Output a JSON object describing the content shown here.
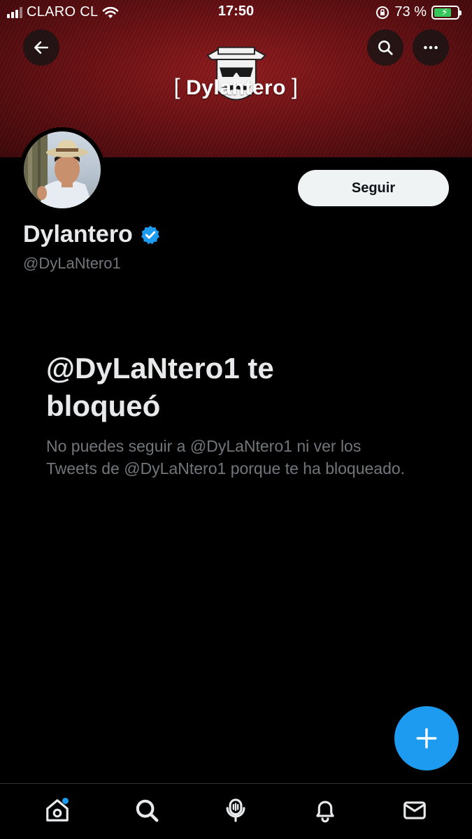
{
  "status_bar": {
    "carrier": "CLARO CL",
    "time": "17:50",
    "battery_percent": "73 %",
    "battery_level": 0.73
  },
  "header": {
    "back_icon": "arrow-left-icon",
    "search_icon": "search-icon",
    "more_icon": "more-horizontal-icon",
    "banner_logo_text": "Dylantero"
  },
  "profile": {
    "display_name": "Dylantero",
    "verified_icon": "verified-badge-icon",
    "handle": "@DyLaNtero1",
    "follow_label": "Seguir"
  },
  "blocked": {
    "title": "@DyLaNtero1 te bloqueó",
    "description": "No puedes seguir a @DyLaNtero1 ni ver los Tweets de @DyLaNtero1 porque te ha bloqueado."
  },
  "fab": {
    "icon": "plus-icon"
  },
  "bottom_nav": {
    "items": [
      {
        "icon": "home-icon",
        "notification_dot": true
      },
      {
        "icon": "search-icon",
        "notification_dot": false
      },
      {
        "icon": "spaces-icon",
        "notification_dot": false
      },
      {
        "icon": "bell-icon",
        "notification_dot": false
      },
      {
        "icon": "mail-icon",
        "notification_dot": false
      }
    ]
  },
  "colors": {
    "accent": "#1d9bf0",
    "banner": "#7a1215",
    "background": "#000000",
    "secondary_text": "#71767b"
  }
}
